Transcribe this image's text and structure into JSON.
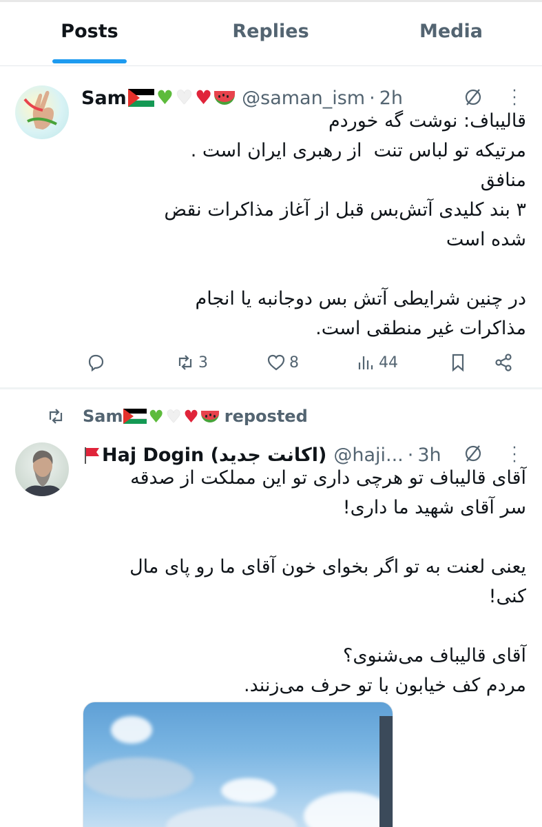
{
  "tabs": [
    {
      "label": "Posts",
      "active": true
    },
    {
      "label": "Replies",
      "active": false
    },
    {
      "label": "Media",
      "active": false
    }
  ],
  "colors": {
    "accent": "#1d9bf0",
    "text": "#0f1419",
    "muted": "#536471"
  },
  "posts": [
    {
      "author_name": "Sam",
      "author_emojis": [
        "palestine-flag",
        "green-heart",
        "white-heart",
        "red-heart",
        "watermelon"
      ],
      "handle": "@saman_ism",
      "separator": "·",
      "time": "2h",
      "text": "قالیباف: نوشت گه خوردم\nمرتیکه تو لباس تنت  از رهبری ایران است .\nمنافق\n۳ بند کلیدی آتش‌بس قبل از آغاز مذاکرات نقض\nشده است\n\nدر چنین شرایطی آتش بس دوجانبه یا انجام\nمذاکرات غیر منطقی است.",
      "replies": "",
      "reposts": "3",
      "likes": "8",
      "views": "44"
    }
  ],
  "repost_banner": {
    "name": "Sam",
    "label": "reposted"
  },
  "reposted_post": {
    "author_name": "Haj Dogin (اکانت جدید)",
    "author_prefix_icon": "red-flag",
    "handle": "@haji...",
    "separator": "·",
    "time": "3h",
    "text": "آقای قالیباف تو هرچی داری تو این مملکت از صدقه\nسر آقای شهید ما داری!\n\nیعنی لعنت به تو اگر بخوای خون آقای ما رو پای مال\nکنی!\n\nآقای قالیباف می‌شنوی؟\nمردم کف خیابون با تو حرف می‌زنند."
  }
}
